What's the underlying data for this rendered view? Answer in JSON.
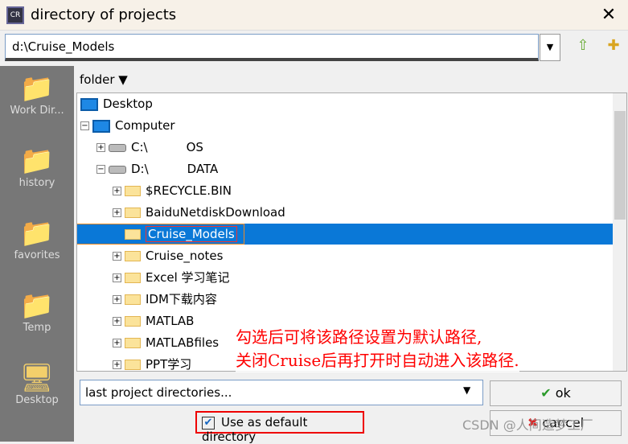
{
  "window": {
    "title": "directory of projects",
    "close": "✕",
    "icon_label": "CR"
  },
  "path": {
    "value": "d:\\Cruise_Models",
    "dropdown": "▼"
  },
  "toolbar": {
    "up_icon": "⇧",
    "new_folder_icon": "✚"
  },
  "sidebar": [
    {
      "label": "Work Dir...",
      "icon": "folder-icon"
    },
    {
      "label": "history",
      "icon": "clock-folder-icon"
    },
    {
      "label": "favorites",
      "icon": "star-folder-icon"
    },
    {
      "label": "Temp",
      "icon": "temp-folder-icon"
    },
    {
      "label": "Desktop",
      "icon": "monitor-icon"
    }
  ],
  "folder_header": "folder ▼",
  "tree": [
    {
      "label": "Desktop",
      "type": "monitor",
      "level": 0,
      "exp": ""
    },
    {
      "label": "Computer",
      "type": "monitor",
      "level": 0,
      "exp": "−"
    },
    {
      "label": "C:\\",
      "extra": "OS",
      "type": "drive",
      "level": 1,
      "exp": "+"
    },
    {
      "label": "D:\\",
      "extra": "DATA",
      "type": "drive",
      "level": 1,
      "exp": "−"
    },
    {
      "label": "$RECYCLE.BIN",
      "type": "folder",
      "level": 2,
      "exp": "+"
    },
    {
      "label": "BaiduNetdiskDownload",
      "type": "folder",
      "level": 2,
      "exp": "+"
    },
    {
      "label": "Cruise_Models",
      "type": "folder",
      "level": 2,
      "exp": "",
      "selected": true
    },
    {
      "label": "Cruise_notes",
      "type": "folder",
      "level": 2,
      "exp": "+"
    },
    {
      "label": "Excel 学习笔记",
      "type": "folder",
      "level": 2,
      "exp": "+"
    },
    {
      "label": "IDM下载内容",
      "type": "folder",
      "level": 2,
      "exp": "+"
    },
    {
      "label": "MATLAB",
      "type": "folder",
      "level": 2,
      "exp": "+"
    },
    {
      "label": "MATLABfiles",
      "type": "folder",
      "level": 2,
      "exp": "+"
    },
    {
      "label": "PPT学习",
      "type": "folder",
      "level": 2,
      "exp": "+"
    }
  ],
  "annotation": {
    "line1": "勾选后可将该路径设置为默认路径,",
    "line2": "关闭Cruise后再打开时自动进入该路径."
  },
  "last_dirs": {
    "value": "last project directories...",
    "dropdown": "▼"
  },
  "buttons": {
    "ok": "ok",
    "ok_icon": "✔",
    "cancel": "cancel",
    "cancel_icon": "✖"
  },
  "default_dir": {
    "label": "Use as default directory",
    "checked": true,
    "check": "✔"
  },
  "watermark": "CSDN @人间造梦工厂",
  "colors": {
    "selection": "#0a78d7",
    "annotation": "#ff0000"
  }
}
